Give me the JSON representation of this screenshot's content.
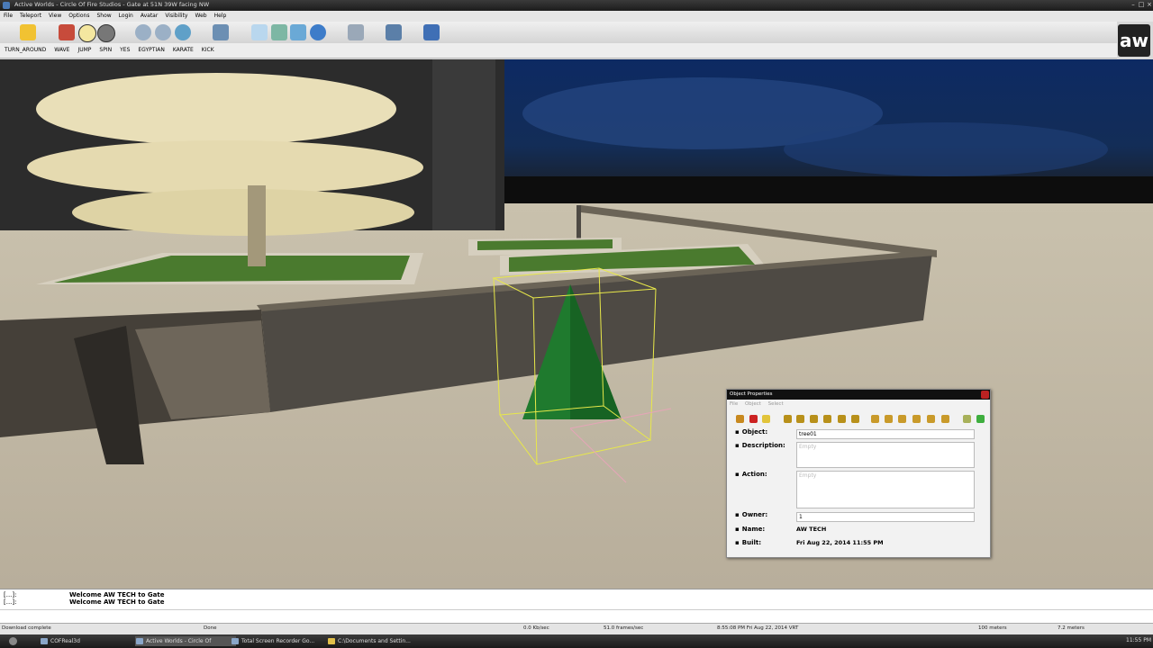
{
  "window": {
    "title": "Active Worlds - Circle Of Fire Studios - Gate at 51N 39W facing NW"
  },
  "menu": [
    "File",
    "Teleport",
    "View",
    "Options",
    "Show",
    "Login",
    "Avatar",
    "Visibility",
    "Web",
    "Help"
  ],
  "gestures": [
    "TURN_AROUND",
    "WAVE",
    "JUMP",
    "SPIN",
    "YES",
    "EGYPTIAN",
    "KARATE",
    "KICK"
  ],
  "logo": {
    "text": "aw"
  },
  "object_properties": {
    "title": "Object Properties",
    "menus": [
      "File",
      "Object",
      "Select"
    ],
    "fields": {
      "object_label": "Object:",
      "object_value": "tree01",
      "description_label": "Description:",
      "description_placeholder": "Empty",
      "action_label": "Action:",
      "action_placeholder": "Empty",
      "owner_label": "Owner:",
      "owner_value": "1",
      "name_label": "Name:",
      "name_value": "AW TECH",
      "built_label": "Built:",
      "built_value": "Fri Aug 22, 2014 11:55 PM"
    }
  },
  "chat": [
    {
      "prefix": "[...]:",
      "message": "Welcome AW TECH to Gate"
    },
    {
      "prefix": "[...]:",
      "message": "Welcome AW TECH to Gate"
    }
  ],
  "status": {
    "left": "Download complete",
    "done": "Done",
    "rate": "0.0 Kb/sec",
    "fps": "51.0 frames/sec",
    "time": "8:55:08 PM Fri Aug 22, 2014 VRT",
    "distance": "100 meters",
    "altitude": "7.2 meters"
  },
  "taskbar": {
    "items": [
      "COFReal3d",
      "Active Worlds - Circle Of",
      "Total Screen Recorder Go...",
      "C:\\Documents and Settin..."
    ],
    "clock": "11:55 PM"
  },
  "colors": {
    "sky": "#0b1f4a",
    "floor": "#c7bfae",
    "wall": "#4e4a44",
    "grass": "#4a7a2e",
    "selection_box": "#e8e84a",
    "tree": "#1f7a2e"
  }
}
